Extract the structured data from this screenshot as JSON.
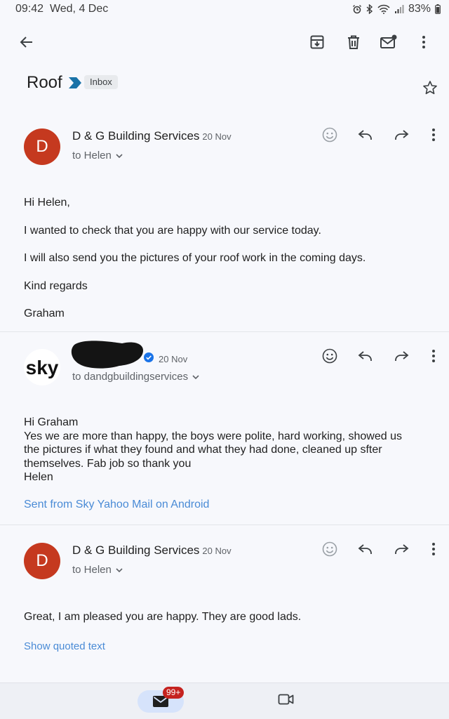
{
  "status_bar": {
    "time": "09:42",
    "date": "Wed, 4 Dec",
    "battery": "83%"
  },
  "toolbar": {
    "back": "back-arrow-icon",
    "archive": "archive-icon",
    "delete": "trash-icon",
    "mark_unread": "mark-unread-icon",
    "more": "more-vert-icon"
  },
  "thread": {
    "subject": "Roof",
    "label": "Inbox"
  },
  "messages": [
    {
      "avatar": "D",
      "sender": "D & G Building Services",
      "date": "20 Nov",
      "to": "to Helen",
      "body": [
        "Hi Helen,",
        "I wanted to check that you are happy with our service today.",
        "I will also send you the pictures of your roof work in the coming days.",
        "Kind regards",
        "Graham"
      ]
    },
    {
      "avatar_logo": "sky",
      "sender": "",
      "date": "20 Nov",
      "to": "to dandgbuildingservices",
      "body": [
        "Hi Graham",
        "Yes we are more than happy, the boys were polite, hard working, showed us",
        "the pictures if what they found and what they had done, cleaned up sfter",
        "themselves. Fab job so thank you",
        "Helen"
      ],
      "signature": "Sent from Sky Yahoo Mail on Android"
    },
    {
      "avatar": "D",
      "sender": "D & G Building Services",
      "date": "20 Nov",
      "to": "to Helen",
      "body": [
        "Great, I am pleased you are happy. They are good lads."
      ],
      "show_quoted": "Show quoted text"
    }
  ],
  "bottom_nav": {
    "mail_badge": "99+"
  },
  "colors": {
    "avatar": "#c5391f",
    "link": "#4a8bd6",
    "importance": "#1a73a8",
    "badge": "#c5221f"
  }
}
